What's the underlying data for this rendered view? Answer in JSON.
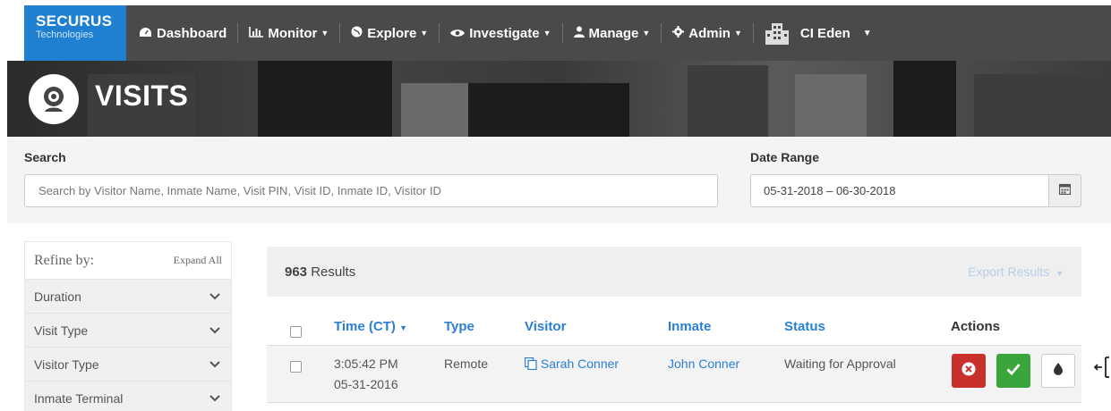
{
  "brand": {
    "name": "SECURUS",
    "sub": "Technologies"
  },
  "nav": {
    "dashboard": "Dashboard",
    "monitor": "Monitor",
    "explore": "Explore",
    "investigate": "Investigate",
    "manage": "Manage",
    "admin": "Admin",
    "user": "CI Eden"
  },
  "page": {
    "title": "VISITS"
  },
  "filters": {
    "search_label": "Search",
    "search_placeholder": "Search by Visitor Name, Inmate Name, Visit PIN, Visit ID, Inmate ID, Visitor ID",
    "date_label": "Date Range",
    "date_value": "05-31-2018 – 06-30-2018"
  },
  "refine": {
    "title": "Refine by:",
    "expand_all": "Expand All",
    "items": [
      {
        "label": "Duration"
      },
      {
        "label": "Visit Type"
      },
      {
        "label": "Visitor Type"
      },
      {
        "label": "Inmate Terminal"
      }
    ]
  },
  "results": {
    "count": "963",
    "count_label": "Results",
    "export": "Export Results"
  },
  "table": {
    "headers": {
      "time": "Time (CT)",
      "type": "Type",
      "visitor": "Visitor",
      "inmate": "Inmate",
      "status": "Status",
      "actions": "Actions"
    },
    "rows": [
      {
        "time": "3:05:42 PM",
        "date": "05-31-2016",
        "type": "Remote",
        "visitor": "Sarah Conner",
        "inmate": "John Conner",
        "status": "Waiting for Approval"
      }
    ]
  },
  "colors": {
    "accent": "#2a7fd4",
    "brand": "#1f7fd1",
    "deny": "#c9302c",
    "approve": "#3aa53a"
  },
  "icons": {
    "dashboard": "tachometer-icon",
    "monitor": "bar-chart-icon",
    "explore": "globe-icon",
    "investigate": "eye-icon",
    "manage": "user-icon",
    "admin": "gear-icon",
    "facility": "building-icon",
    "page": "webcam-icon",
    "calendar": "calendar-icon",
    "deny": "times-circle-icon",
    "approve": "check-icon",
    "more": "drop-icon"
  }
}
